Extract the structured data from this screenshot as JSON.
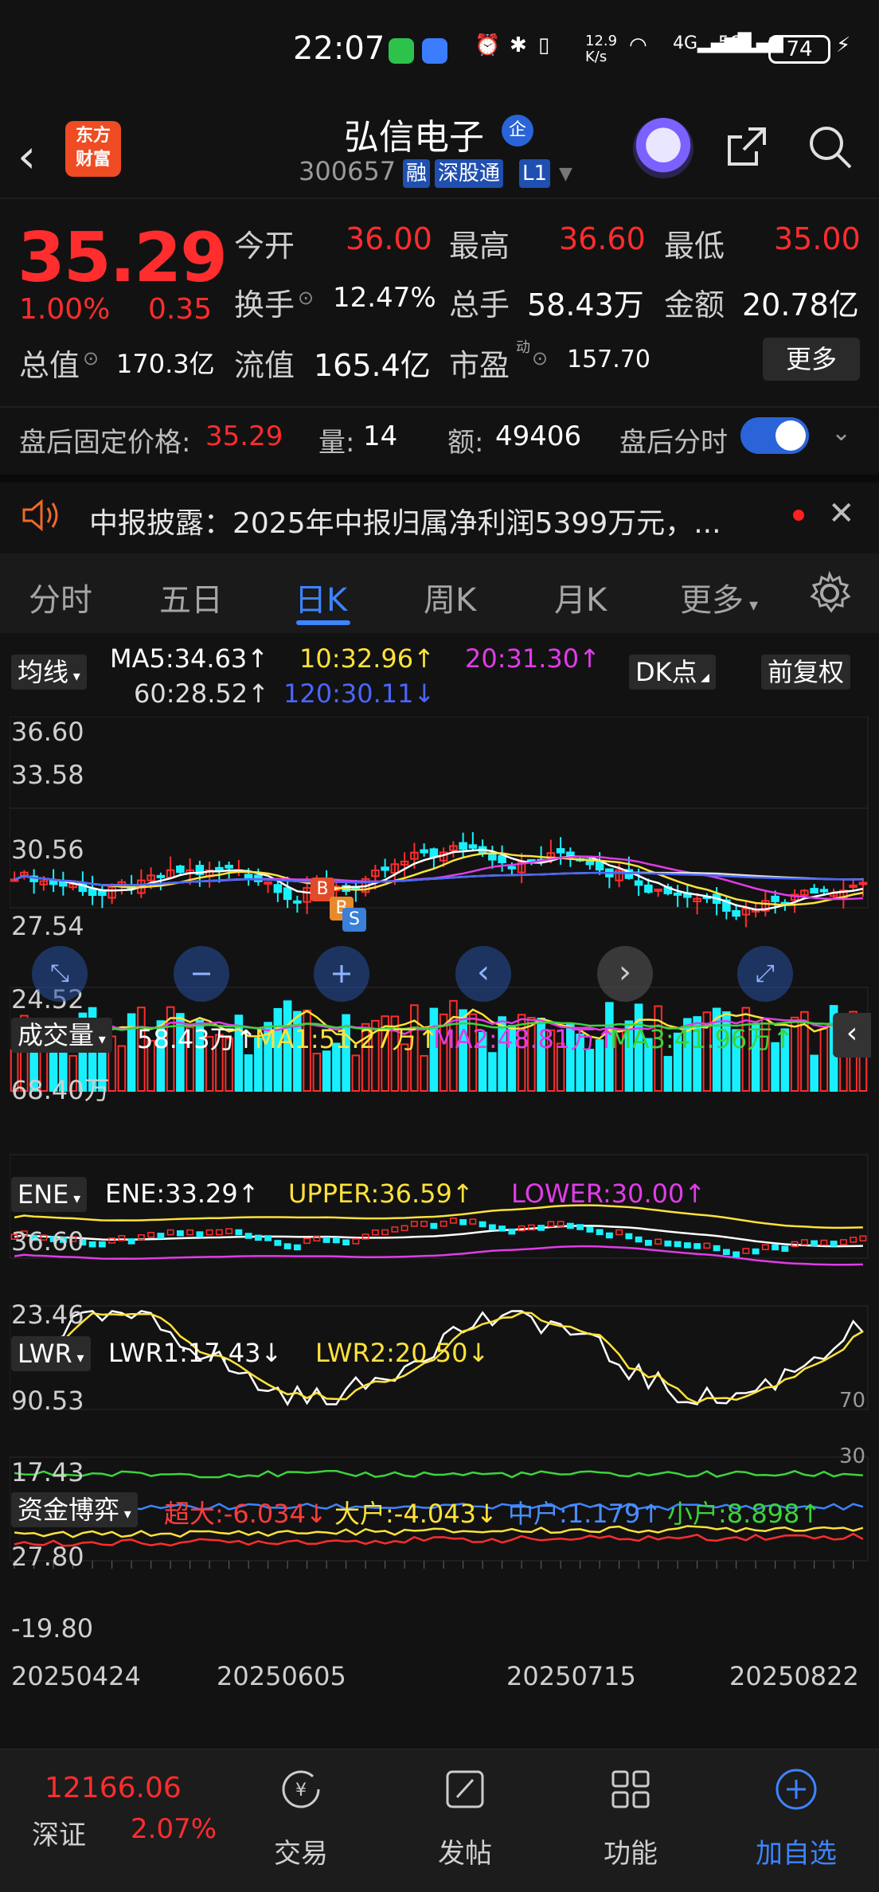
{
  "status_bar": {
    "time": "22:07",
    "net_speed": "12.9\nK/s",
    "battery": "74"
  },
  "header": {
    "logo_line1": "东方",
    "logo_line2": "财富",
    "stock_name": "弘信电子",
    "qi_badge": "企",
    "stock_code": "300657",
    "tags": [
      "融",
      "深股通",
      "L1"
    ]
  },
  "quote": {
    "price": "35.29",
    "change_pct": "1.00%",
    "change_amt": "0.35",
    "open_label": "今开",
    "open": "36.00",
    "high_label": "最高",
    "high": "36.60",
    "low_label": "最低",
    "low": "35.00",
    "turnover_label": "换手",
    "turnover": "12.47%",
    "volume_label": "总手",
    "volume": "58.43万",
    "amount_label": "金额",
    "amount": "20.78亿",
    "mcap_label": "总值",
    "mcap": "170.3亿",
    "float_label": "流值",
    "float_val": "165.4亿",
    "pe_label": "市盈",
    "pe_sup": "动",
    "pe": "157.70",
    "more_btn": "更多"
  },
  "after_hours": {
    "price_label": "盘后固定价格:",
    "price": "35.29",
    "vol_label": "量:",
    "vol": "14",
    "amt_label": "额:",
    "amt": "49406",
    "toggle_label": "盘后分时"
  },
  "notice": {
    "text": "中报披露：2025年中报归属净利润5399万元，..."
  },
  "tabs": [
    "分时",
    "五日",
    "日K",
    "周K",
    "月K",
    "更多"
  ],
  "active_tab": "日K",
  "indicators": {
    "ma_dropdown": "均线",
    "ma5": "MA5:34.63↑",
    "ma10": "10:32.96↑",
    "ma20": "20:31.30↑",
    "ma60": "60:28.52↑",
    "ma120": "120:30.11↓",
    "dk_btn": "DK点",
    "fq_btn": "前复权",
    "price_axis": [
      "36.60",
      "33.58",
      "30.56",
      "27.54",
      "24.52"
    ],
    "vol_dropdown": "成交量",
    "vol_val": "58.43万↑",
    "vol_ma1": "MA1:51.27万↑",
    "vol_ma2": "MA2:48.81万↑",
    "vol_ma3": "MA3:41.96万↑",
    "vol_axis": "68.40万",
    "ene_dropdown": "ENE",
    "ene_val": "ENE:33.29↑",
    "ene_upper": "UPPER:36.59↑",
    "ene_lower": "LOWER:30.00↑",
    "ene_axis_top": "36.60",
    "ene_axis_bot": "23.46",
    "lwr_dropdown": "LWR",
    "lwr1": "LWR1:17.43↓",
    "lwr2": "LWR2:20.50↓",
    "lwr_axis_top": "90.53",
    "lwr_axis_bot": "17.43",
    "lwr_right_top": "70",
    "lwr_right_bot": "30",
    "fund_dropdown": "资金博弈",
    "fund_super": "超大:-6.034↓",
    "fund_big": "大户:-4.043↓",
    "fund_mid": "中户:1.179↑",
    "fund_small": "小户:8.898↑",
    "fund_axis_top": "27.80",
    "fund_axis_bot": "-19.80",
    "dates": [
      "20250424",
      "20250605",
      "20250715",
      "20250822"
    ],
    "markers": [
      "B",
      "B",
      "S"
    ]
  },
  "bottom_nav": {
    "index_value": "12166.06",
    "index_name": "深证",
    "index_change": "2.07%",
    "trade": "交易",
    "post": "发帖",
    "func": "功能",
    "add": "加自选"
  },
  "colors": {
    "red": "#ff2d2d",
    "accent": "#3d84ff",
    "yellow": "#ffe23a",
    "magenta": "#e13ce8",
    "cyan": "#19f0ff",
    "green": "#3cd43c"
  }
}
